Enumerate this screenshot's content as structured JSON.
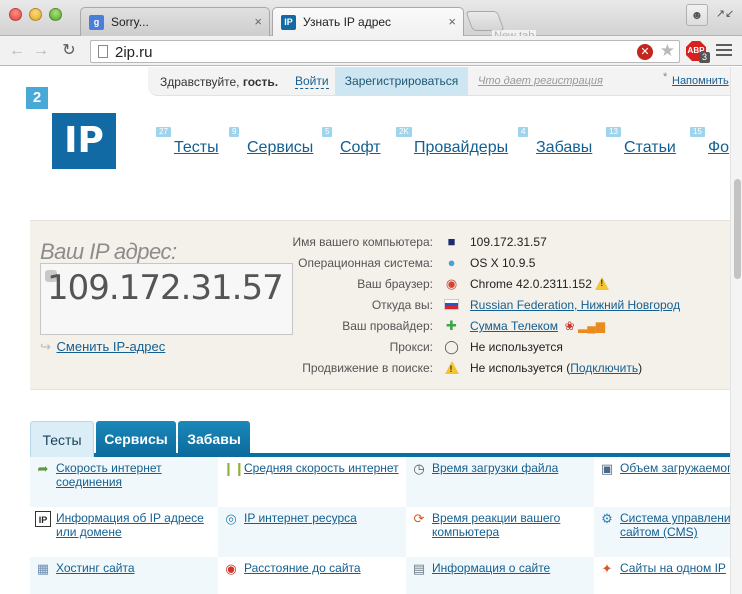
{
  "browser": {
    "tabs": [
      {
        "title": "Sorry...",
        "favicon": "google-icon"
      },
      {
        "title": "Узнать IP адрес",
        "favicon": "2ip-icon"
      }
    ],
    "newtab_tooltip": "New tab",
    "address": "2ip.ru",
    "extension_badge": "ABP",
    "extension_count": "3"
  },
  "loginbar": {
    "greeting_prefix": "Здравствуйте, ",
    "greeting_name": "гость.",
    "login": "Войти",
    "register": "Зарегистрироваться",
    "why_register": "Что дает регистрация",
    "remind_star": "*",
    "remind": "Напомнить"
  },
  "logo": {
    "small": "2",
    "big": "IP"
  },
  "nav": [
    {
      "badge": "27",
      "label": "Тесты"
    },
    {
      "badge": "9",
      "label": "Сервисы"
    },
    {
      "badge": "5",
      "label": "Софт"
    },
    {
      "badge": "2K",
      "label": "Провайдеры"
    },
    {
      "badge": "4",
      "label": "Забавы"
    },
    {
      "badge": "13",
      "label": "Статьи"
    },
    {
      "badge": "15",
      "label": "Фо"
    }
  ],
  "ip": {
    "title": "Ваш IP адрес:",
    "value": "109.172.31.57",
    "change": "Сменить IP-адрес"
  },
  "info": [
    {
      "label": "Имя вашего компьютера:",
      "icon": "computer-icon",
      "value": "109.172.31.57",
      "link": false
    },
    {
      "label": "Операционная система:",
      "icon": "apple-icon",
      "value": "OS X 10.9.5",
      "link": false
    },
    {
      "label": "Ваш браузер:",
      "icon": "chrome-icon",
      "value": "Chrome 42.0.2311.152",
      "link": false
    },
    {
      "label": "Откуда вы:",
      "icon": "russia-flag-icon",
      "value": "Russian Federation, Нижний Новгород",
      "link": true
    },
    {
      "label": "Ваш провайдер:",
      "icon": "provider-icon",
      "value": "Сумма Телеком",
      "link": true
    },
    {
      "label": "Прокси:",
      "icon": "glasses-icon",
      "value": "Не используется",
      "link": false
    },
    {
      "label": "Продвижение в поиске:",
      "icon": "warning-icon",
      "value": "Не используется (",
      "link_text": "Подключить",
      "value_end": ")",
      "link": false
    }
  ],
  "section_tabs": [
    "Тесты",
    "Сервисы",
    "Забавы"
  ],
  "tests": [
    {
      "icon": "speed-arrow-icon",
      "label": "Скорость интернет соединения"
    },
    {
      "icon": "bars-icon",
      "label": "Средняя скорость интернет"
    },
    {
      "icon": "clock-icon",
      "label": "Время загрузки файла"
    },
    {
      "icon": "file-size-icon",
      "label": "Объем загружаемого файла"
    },
    {
      "icon": "ip-info-icon",
      "label": "Информация об IP адресе или домене"
    },
    {
      "icon": "ip-resource-icon",
      "label": "IP интернет ресурса"
    },
    {
      "icon": "reaction-icon",
      "label": "Время реакции вашего компьютера"
    },
    {
      "icon": "cms-icon",
      "label": "Система управления сайтом (CMS)"
    },
    {
      "icon": "hosting-icon",
      "label": "Хостинг сайта"
    },
    {
      "icon": "map-pin-icon",
      "label": "Расстояние до сайта"
    },
    {
      "icon": "site-info-icon",
      "label": "Информация о сайте"
    },
    {
      "icon": "sites-one-ip-icon",
      "label": "Сайты на одном IP"
    }
  ]
}
